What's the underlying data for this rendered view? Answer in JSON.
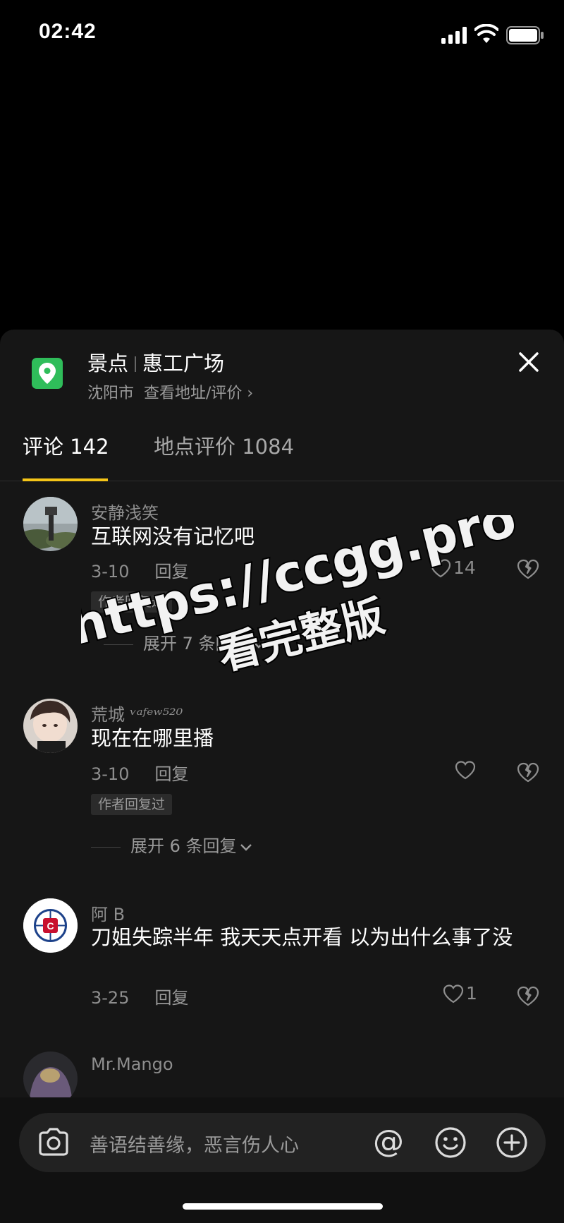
{
  "status_bar": {
    "time": "02:42"
  },
  "location": {
    "category": "景点",
    "name": "惠工广场",
    "city": "沈阳市",
    "address_link": "查看地址/评价 ›"
  },
  "tabs": [
    {
      "label": "评论 142",
      "active": true
    },
    {
      "label": "地点评价 1084",
      "active": false
    }
  ],
  "comments": [
    {
      "user": "安静浅笑",
      "text": "互联网没有记忆吧",
      "date": "3-10",
      "reply_label": "回复",
      "likes": "14",
      "badge": "作者回复过",
      "expand": "展开 7 条回复"
    },
    {
      "user": "荒城",
      "user_suffix": "ᵛᵃᶠᵉʷ⁵²⁰",
      "text": "现在在哪里播",
      "date": "3-10",
      "reply_label": "回复",
      "likes": "",
      "badge": "作者回复过",
      "expand": "展开 6 条回复"
    },
    {
      "user": "阿 B",
      "text": "刀姐失踪半年 我天天点开看 以为出什么事了没",
      "date": "3-25",
      "reply_label": "回复",
      "likes": "1"
    },
    {
      "user": "Mr.Mango"
    }
  ],
  "watermark": {
    "line1": "https://ccgg.pro",
    "line2": "看完整版"
  },
  "input": {
    "placeholder": "善语结善缘，恶言伤人心",
    "at_symbol": "@"
  },
  "colors": {
    "accent": "#f5c518",
    "location_pin": "#2fbd5a",
    "sheet_bg": "#161616"
  }
}
